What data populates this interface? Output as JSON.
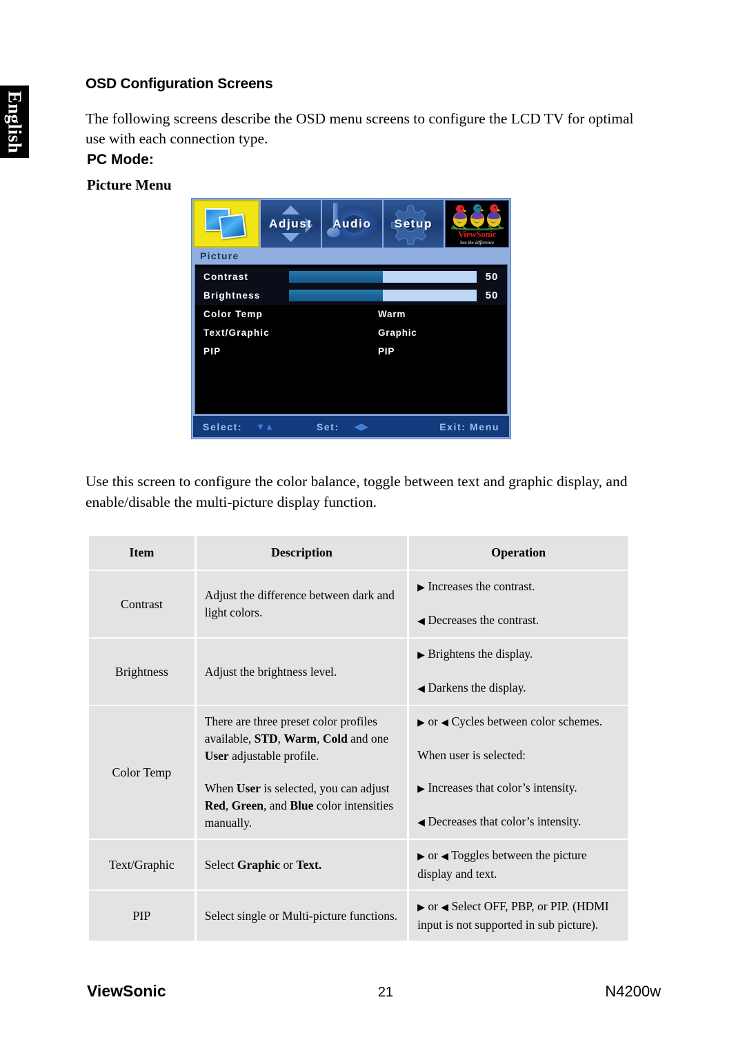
{
  "language_tab": "English",
  "headings": {
    "section": "OSD Configuration Screens",
    "mode": "PC Mode:",
    "menu": "Picture Menu"
  },
  "paragraphs": {
    "intro": "The following screens describe the OSD menu screens to configure the LCD TV for optimal use with each connection type.",
    "usage": "Use this screen to configure the color balance, toggle between text and graphic display, and enable/disable the multi-picture display function."
  },
  "osd": {
    "tabs": [
      {
        "label": "",
        "icon": "picture-icon",
        "selected": true
      },
      {
        "label": "Adjust",
        "icon": "adjust-arrows-icon",
        "selected": false
      },
      {
        "label": "Audio",
        "icon": "speaker-note-icon",
        "selected": false
      },
      {
        "label": "Setup",
        "icon": "gear-icon",
        "selected": false
      }
    ],
    "logo": {
      "word": "ViewSonic",
      "tagline": "See the difference"
    },
    "section_title": "Picture",
    "rows": [
      {
        "label": "Contrast",
        "type": "slider",
        "value": "50",
        "percent": 50
      },
      {
        "label": "Brightness",
        "type": "slider",
        "value": "50",
        "percent": 50
      },
      {
        "label": "Color Temp",
        "type": "value",
        "value": "Warm"
      },
      {
        "label": "Text/Graphic",
        "type": "value",
        "value": "Graphic"
      },
      {
        "label": "PIP",
        "type": "value",
        "value": "PIP"
      }
    ],
    "status": {
      "select_label": "Select:",
      "select_glyph": "▼▲",
      "set_label": "Set:",
      "set_glyph": "◀▶",
      "exit_label": "Exit: Menu"
    },
    "colors": {
      "frame": "#8fadde",
      "highlight": "#f2e516",
      "bar_fill": "#1b6396",
      "bar_track": "#bcd8f5",
      "status_bar": "#123a7d"
    }
  },
  "table": {
    "headers": [
      "Item",
      "Description",
      "Operation"
    ],
    "rows": [
      {
        "item": "Contrast",
        "description": [
          "Adjust the difference between dark and light colors."
        ],
        "operation": [
          "▶ Increases the contrast.",
          "◀ Decreases the contrast."
        ]
      },
      {
        "item": "Brightness",
        "description": [
          "Adjust the brightness level."
        ],
        "operation": [
          "▶ Brightens the display.",
          "◀ Darkens the display."
        ]
      },
      {
        "item": "Color Temp",
        "description": [
          "There are three preset color profiles available, STD, Warm, Cold and one User adjustable profile.",
          "When User is selected, you can adjust Red, Green, and Blue color intensities manually."
        ],
        "operation": [
          "▶ or ◀ Cycles between color schemes.",
          "When user is selected:",
          "▶ Increases that color’s intensity.",
          "◀ Decreases that color’s intensity."
        ]
      },
      {
        "item": "Text/Graphic",
        "description": [
          "Select Graphic or Text."
        ],
        "operation": [
          "▶ or ◀ Toggles between the picture display and text."
        ]
      },
      {
        "item": "PIP",
        "description": [
          "Select single or Multi-picture functions."
        ],
        "operation": [
          "▶ or ◀ Select OFF, PBP, or PIP. (HDMI input is not supported in sub picture)."
        ]
      }
    ]
  },
  "footer": {
    "brand": "ViewSonic",
    "page_number": "21",
    "model": "N4200w"
  }
}
